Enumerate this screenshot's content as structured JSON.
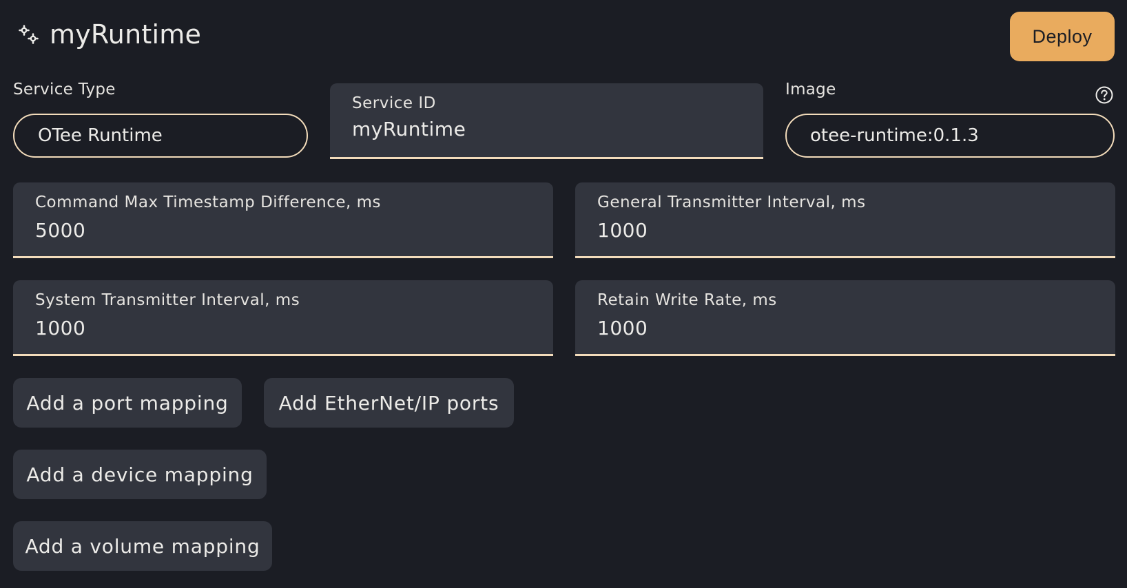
{
  "header": {
    "title": "myRuntime",
    "icon": "gears-icon",
    "deploy_label": "Deploy"
  },
  "colors": {
    "background": "#1b1d24",
    "surface": "#32353e",
    "accent": "#e9ab5e",
    "underline": "#f3dcbb"
  },
  "fields": {
    "service_type": {
      "label": "Service Type",
      "value": "OTee Runtime"
    },
    "service_id": {
      "label": "Service ID",
      "value": "myRuntime"
    },
    "image": {
      "label": "Image",
      "value": "otee-runtime:0.1.3",
      "help_icon": "help-circle-icon"
    },
    "cmd_max_ts_diff": {
      "label": "Command Max Timestamp Difference, ms",
      "value": "5000"
    },
    "general_tx_interval": {
      "label": "General Transmitter Interval, ms",
      "value": "1000"
    },
    "system_tx_interval": {
      "label": "System Transmitter Interval, ms",
      "value": "1000"
    },
    "retain_write_rate": {
      "label": "Retain Write Rate, ms",
      "value": "1000"
    }
  },
  "actions": {
    "add_port_mapping": "Add a port mapping",
    "add_ethernet_ip_ports": "Add EtherNet/IP ports",
    "add_device_mapping": "Add a device mapping",
    "add_volume_mapping": "Add a volume mapping"
  }
}
